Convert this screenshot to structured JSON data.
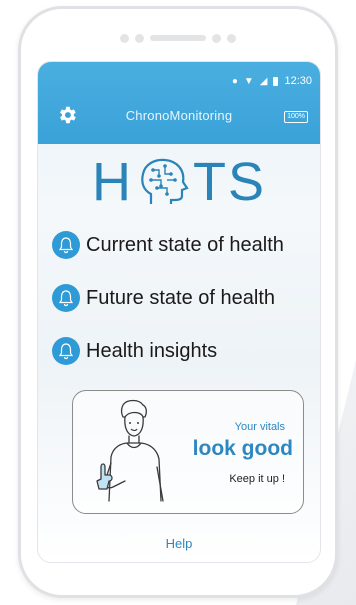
{
  "status_bar": {
    "time": "12:30"
  },
  "header": {
    "title": "ChronoMonitoring",
    "battery": "100%"
  },
  "logo": {
    "left": "H",
    "right": "TS"
  },
  "menu": [
    {
      "label": "Current state of health",
      "icon": "bell-icon"
    },
    {
      "label": "Future state of health",
      "icon": "bell-icon"
    },
    {
      "label": "Health insights",
      "icon": "bell-icon"
    }
  ],
  "vitals_card": {
    "line1": "Your vitals",
    "line2": "look good",
    "line3": "Keep it up !"
  },
  "footer": {
    "help": "Help"
  },
  "colors": {
    "accent": "#3aa2d8",
    "text_accent": "#2e88c0"
  }
}
